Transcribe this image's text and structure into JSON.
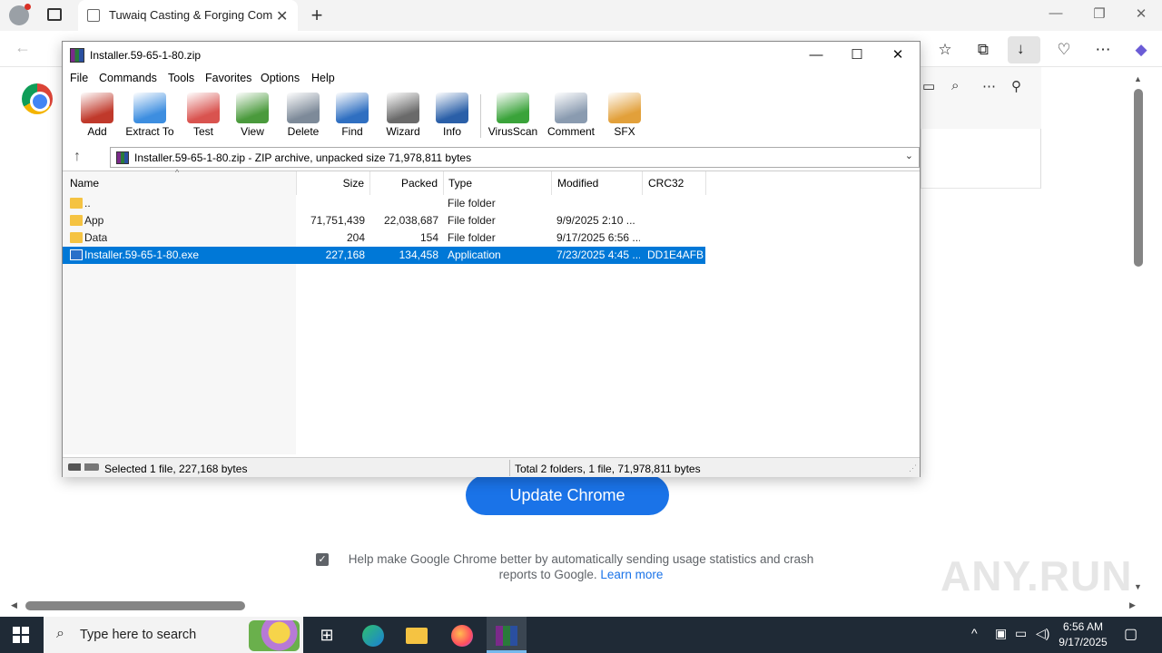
{
  "browser": {
    "tab_title": "Tuwaiq Casting & Forging Company",
    "new_tab": "+",
    "minimize": "—",
    "restore": "❐",
    "close": "✕"
  },
  "page": {
    "update_button": "Update Chrome",
    "stats_text": "Help make Google Chrome better by automatically sending usage statistics and crash reports to Google.",
    "learn_more": "Learn more",
    "checkbox_mark": "✓",
    "watermark": "ANY.RUN"
  },
  "rar": {
    "title": "Installer.59-65-1-80.zip",
    "menu": [
      "File",
      "Commands",
      "Tools",
      "Favorites",
      "Options",
      "Help"
    ],
    "toolbar": [
      {
        "label": "Add",
        "icon": "add-icon",
        "color": "#c0392b"
      },
      {
        "label": "Extract To",
        "icon": "extract-icon",
        "color": "#3d8ee0"
      },
      {
        "label": "Test",
        "icon": "test-icon",
        "color": "#d9534f"
      },
      {
        "label": "View",
        "icon": "view-icon",
        "color": "#4a9a3c"
      },
      {
        "label": "Delete",
        "icon": "delete-icon",
        "color": "#7d8a99"
      },
      {
        "label": "Find",
        "icon": "find-icon",
        "color": "#2f6fc1"
      },
      {
        "label": "Wizard",
        "icon": "wizard-icon",
        "color": "#6a6a6a"
      },
      {
        "label": "Info",
        "icon": "info-icon",
        "color": "#2a5fa8"
      },
      {
        "label": "VirusScan",
        "icon": "virusscan-icon",
        "color": "#3aa33a"
      },
      {
        "label": "Comment",
        "icon": "comment-icon",
        "color": "#8a9bb0"
      },
      {
        "label": "SFX",
        "icon": "sfx-icon",
        "color": "#e2a03a"
      }
    ],
    "path_text": "Installer.59-65-1-80.zip - ZIP archive, unpacked size 71,978,811 bytes",
    "columns": [
      "Name",
      "Size",
      "Packed",
      "Type",
      "Modified",
      "CRC32"
    ],
    "rows": [
      {
        "name": "..",
        "size": "",
        "packed": "",
        "type": "File folder",
        "modified": "",
        "crc": "",
        "icon": "folder-icon"
      },
      {
        "name": "App",
        "size": "71,751,439",
        "packed": "22,038,687",
        "type": "File folder",
        "modified": "9/9/2025 2:10 ...",
        "crc": "",
        "icon": "folder-icon"
      },
      {
        "name": "Data",
        "size": "204",
        "packed": "154",
        "type": "File folder",
        "modified": "9/17/2025 6:56 ...",
        "crc": "",
        "icon": "folder-icon"
      },
      {
        "name": "Installer.59-65-1-80.exe",
        "size": "227,168",
        "packed": "134,458",
        "type": "Application",
        "modified": "7/23/2025 4:45 ...",
        "crc": "DD1E4AFB",
        "icon": "application-icon",
        "selected": true
      }
    ],
    "status_left": "Selected 1 file, 227,168 bytes",
    "status_right": "Total 2 folders, 1 file, 71,978,811 bytes"
  },
  "taskbar": {
    "search_placeholder": "Type here to search",
    "time": "6:56 AM",
    "date": "9/17/2025"
  }
}
